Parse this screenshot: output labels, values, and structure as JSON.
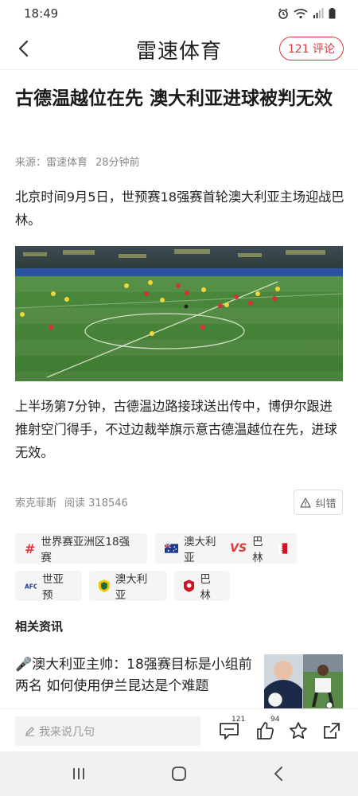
{
  "status_bar": {
    "time": "18:49"
  },
  "header": {
    "title": "雷速体育",
    "comment_button": "121 评论"
  },
  "article": {
    "title": "古德温越位在先 澳大利亚进球被判无效",
    "source": "来源：雷速体育",
    "time_ago": "28分钟前",
    "paragraph1": "北京时间9月5日，世预赛18强赛首轮澳大利亚主场迎战巴林。",
    "paragraph2": "上半场第7分钟，古德温边路接球送出传中，博伊尔跟进推射空门得手，不过边裁举旗示意古德温越位在先，进球无效。",
    "author": "索克菲斯",
    "read_label": "阅读 318546",
    "report_button": "纠错"
  },
  "tags": {
    "competition": "世界赛亚洲区18强赛",
    "match_home": "澳大利亚",
    "match_vs": "VS",
    "match_away": "巴林",
    "league": "世亚预",
    "team1": "澳大利亚",
    "team2": "巴林"
  },
  "related": {
    "section_title": "相关资讯",
    "items": [
      {
        "title": "🎤澳大利亚主帅：18强赛目标是小组前两名 如何使用伊兰昆达是个难题"
      }
    ]
  },
  "bottom_bar": {
    "comment_placeholder": "我来说几句",
    "comment_count": "121",
    "like_count": "94"
  },
  "colors": {
    "accent": "#e0353b",
    "text": "#222222",
    "meta": "#888888"
  }
}
